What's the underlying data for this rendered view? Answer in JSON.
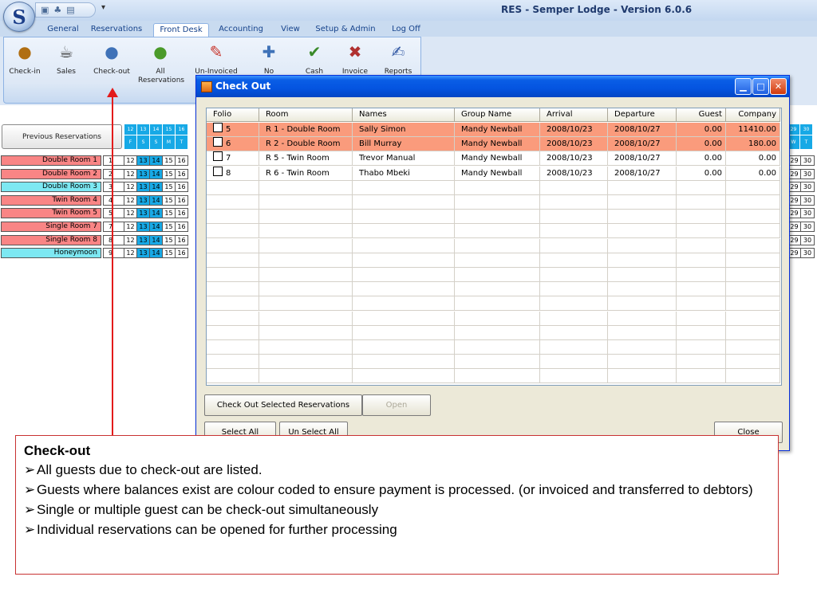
{
  "app": {
    "title": "RES - Semper Lodge - Version 6.0.6",
    "orb_letter": "S",
    "qat_icons": [
      "save-icon",
      "users-icon",
      "print-icon"
    ]
  },
  "ribbon": {
    "tabs": [
      "General",
      "Reservations",
      "Front Desk",
      "Accounting",
      "View",
      "Setup & Admin",
      "Log Off"
    ],
    "active_tab": "Front Desk",
    "buttons": [
      {
        "label": "Check-in",
        "icon": "check-in-icon"
      },
      {
        "label": "Sales",
        "icon": "coffee-icon"
      },
      {
        "label": "Check-out",
        "icon": "check-out-icon"
      },
      {
        "label": "All Reservations",
        "icon": "all-reservations-icon"
      },
      {
        "label": "Un-Invoiced",
        "icon": "un-invoiced-icon"
      },
      {
        "label": "No",
        "icon": "no-icon"
      },
      {
        "label": "Cash",
        "icon": "cash-icon"
      },
      {
        "label": "Invoice",
        "icon": "invoice-icon"
      },
      {
        "label": "Reports",
        "icon": "reports-icon"
      }
    ]
  },
  "calendar": {
    "previous_button": "Previous Reservations",
    "head_dates": [
      "12",
      "13",
      "14",
      "15",
      "16"
    ],
    "head_days": [
      "F",
      "S",
      "S",
      "M",
      "T"
    ],
    "right_dates": [
      "29",
      "30"
    ],
    "right_days": [
      "W",
      "T"
    ],
    "rooms": [
      {
        "name": "Double Room 1",
        "num": "1",
        "color": "#f98585"
      },
      {
        "name": "Double Room 2",
        "num": "2",
        "color": "#f98585"
      },
      {
        "name": "Double Room 3",
        "num": "3",
        "color": "#7de8f2"
      },
      {
        "name": "Twin Room 4",
        "num": "4",
        "color": "#f98585"
      },
      {
        "name": "Twin Room 5",
        "num": "5",
        "color": "#f98585"
      },
      {
        "name": "Single Room 7",
        "num": "7",
        "color": "#f98585"
      },
      {
        "name": "Single  Room 8",
        "num": "8",
        "color": "#f98585"
      },
      {
        "name": "Honeymoon",
        "num": "9",
        "color": "#7de8f2"
      }
    ],
    "row_days": [
      "12",
      "13",
      "14",
      "15",
      "16"
    ],
    "row_days_right": [
      "29",
      "30"
    ]
  },
  "dialog": {
    "title": "Check Out",
    "columns": [
      "Folio",
      "Room",
      "Names",
      "Group Name",
      "Arrival",
      "Departure",
      "Guest",
      "Company"
    ],
    "rows": [
      {
        "folio": "5",
        "room": "R 1 - Double Room",
        "names": "Sally Simon",
        "group": "Mandy Newball",
        "arrival": "2008/10/23",
        "departure": "2008/10/27",
        "guest": "0.00",
        "company": "11410.00",
        "highlight": true
      },
      {
        "folio": "6",
        "room": "R 2 - Double Room",
        "names": "Bill Murray",
        "group": "Mandy Newball",
        "arrival": "2008/10/23",
        "departure": "2008/10/27",
        "guest": "0.00",
        "company": "180.00",
        "highlight": true
      },
      {
        "folio": "7",
        "room": "R 5 - Twin Room",
        "names": "Trevor Manual",
        "group": "Mandy Newball",
        "arrival": "2008/10/23",
        "departure": "2008/10/27",
        "guest": "0.00",
        "company": "0.00",
        "highlight": false
      },
      {
        "folio": "8",
        "room": "R 6 - Twin Room",
        "names": "Thabo Mbeki",
        "group": "Mandy Newball",
        "arrival": "2008/10/23",
        "departure": "2008/10/27",
        "guest": "0.00",
        "company": "0.00",
        "highlight": false
      }
    ],
    "highlight_color": "#fa9b7c",
    "buttons": {
      "checkout_selected": "Check Out Selected Reservations",
      "open": "Open",
      "select_all": "Select All",
      "unselect_all": "Un Select All",
      "close": "Close"
    }
  },
  "caption": {
    "title": "Check-out",
    "bullet": "➢",
    "points": [
      "All guests due to check-out are listed.",
      "Guests where balances exist are colour coded to ensure payment is processed. (or invoiced and transferred to debtors)",
      "Single or multiple guest can be check-out simultaneously",
      "Individual reservations can be opened for further processing"
    ]
  },
  "colors": {
    "accent_red": "#e31b1b",
    "calendar_weekend": "#17a9e6"
  }
}
